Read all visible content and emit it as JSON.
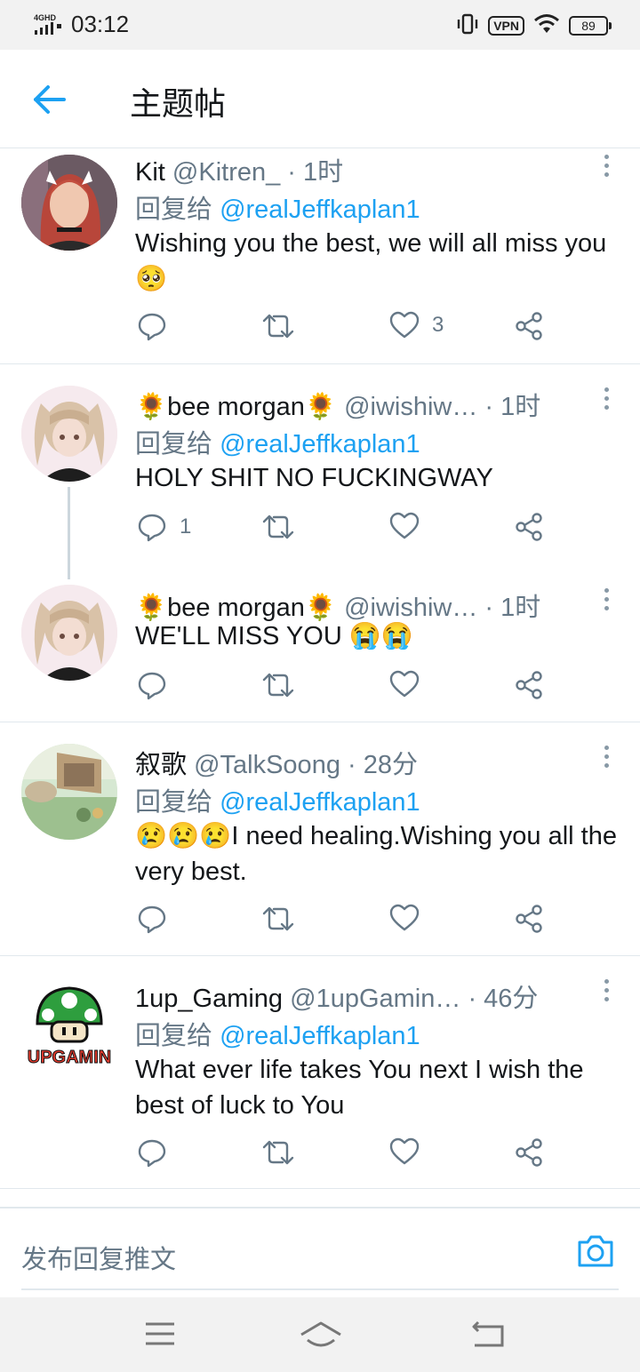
{
  "status_bar": {
    "network": "4GHD",
    "time": "03:12",
    "vpn": "VPN",
    "battery": "89"
  },
  "header": {
    "title": "主题帖"
  },
  "tweets": [
    {
      "name": "Kit",
      "handle": "@Kitren_",
      "time": "· 1时",
      "reply_prefix": "回复给",
      "reply_to": "@realJeffkaplan1",
      "text": "Wishing you the best, we will all miss you🥺",
      "reply_count": "",
      "like_count": "3"
    },
    {
      "name": "🌻bee morgan🌻",
      "handle": "@iwishiw…",
      "time": "· 1时",
      "reply_prefix": "回复给",
      "reply_to": "@realJeffkaplan1",
      "text": "HOLY SHIT NO FUCKINGWAY",
      "reply_count": "1",
      "like_count": ""
    },
    {
      "name": "🌻bee morgan🌻",
      "handle": "@iwishiw…",
      "time": "· 1时",
      "text": "WE'LL MISS YOU 😭😭",
      "reply_count": "",
      "like_count": ""
    },
    {
      "name": "叙歌",
      "handle": "@TalkSoong",
      "time": "· 28分",
      "reply_prefix": "回复给",
      "reply_to": "@realJeffkaplan1",
      "text": "😢😢😢I need healing.Wishing you all the very best.",
      "reply_count": "",
      "like_count": ""
    },
    {
      "name": "1up_Gaming",
      "handle": "@1upGamin…",
      "time": "· 46分",
      "reply_prefix": "回复给",
      "reply_to": "@realJeffkaplan1",
      "text": "What ever life takes You next I wish the best of luck to You",
      "reply_count": "",
      "like_count": "",
      "avatar_text": "UPGAMIN"
    }
  ],
  "composer": {
    "placeholder": "发布回复推文"
  },
  "colors": {
    "accent": "#1da1f2",
    "secondary_text": "#657786",
    "divider": "#e1e8ed"
  },
  "icons": [
    "back-arrow-icon",
    "more-vert-icon",
    "reply-icon",
    "retweet-icon",
    "like-icon",
    "share-icon",
    "camera-icon",
    "menu-icon",
    "home-icon",
    "return-icon"
  ]
}
